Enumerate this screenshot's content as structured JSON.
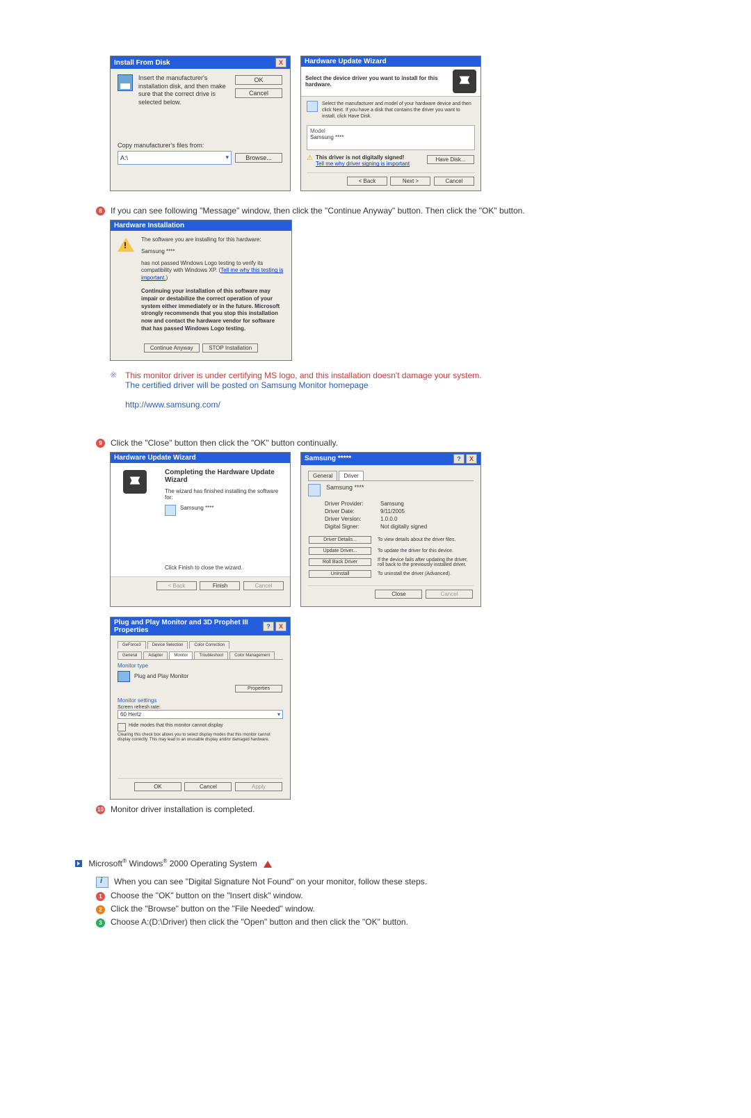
{
  "install_from_disk": {
    "title": "Install From Disk",
    "instr": "Insert the manufacturer's installation disk, and then make sure that the correct drive is selected below.",
    "ok": "OK",
    "cancel": "Cancel",
    "copy_label": "Copy manufacturer's files from:",
    "dropdown_value": "A:\\",
    "browse": "Browse..."
  },
  "hw_update_select": {
    "title": "Hardware Update Wizard",
    "heading": "Select the device driver you want to install for this hardware.",
    "instr": "Select the manufacturer and model of your hardware device and then click Next. If you have a disk that contains the driver you want to install, click Have Disk.",
    "model_label": "Model",
    "model_value": "Samsung ****",
    "warn": "This driver is not digitally signed!",
    "warn_link": "Tell me why driver signing is important",
    "have_disk": "Have Disk...",
    "back": "< Back",
    "next": "Next >",
    "cancel": "Cancel"
  },
  "step8": {
    "num": "8",
    "text": "If you can see following \"Message\" window, then click the \"Continue Anyway\" button. Then click the \"OK\" button."
  },
  "hw_install": {
    "title": "Hardware Installation",
    "line1": "The software you are installing for this hardware:",
    "device": "Samsung ****",
    "line2a": "has not passed Windows Logo testing to verify its compatibility with Windows XP. (",
    "line2_link": "Tell me why this testing is important.",
    "line2b": ")",
    "bold": "Continuing your installation of this software may impair or destabilize the correct operation of your system either immediately or in the future. Microsoft strongly recommends that you stop this installation now and contact the hardware vendor for software that has passed Windows Logo testing.",
    "continue": "Continue Anyway",
    "stop": "STOP Installation"
  },
  "note": {
    "red": "This monitor driver is under certifying MS logo, and this installation doesn't damage your system.",
    "blue": "The certified driver will be posted on Samsung Monitor homepage",
    "url": "http://www.samsung.com/"
  },
  "step9": {
    "num": "9",
    "text": "Click the \"Close\" button then click the \"OK\" button continually."
  },
  "hw_complete": {
    "title": "Hardware Update Wizard",
    "heading": "Completing the Hardware Update Wizard",
    "sub": "The wizard has finished installing the software for:",
    "device": "Samsung ****",
    "hint": "Click Finish to close the wizard.",
    "back": "< Back",
    "finish": "Finish",
    "cancel": "Cancel"
  },
  "driver_props": {
    "title": "Samsung *****",
    "tab_general": "General",
    "tab_driver": "Driver",
    "device": "Samsung ****",
    "prov_l": "Driver Provider:",
    "prov_v": "Samsung",
    "date_l": "Driver Date:",
    "date_v": "9/11/2005",
    "ver_l": "Driver Version:",
    "ver_v": "1.0.0.0",
    "sig_l": "Digital Signer:",
    "sig_v": "Not digitally signed",
    "btn_details": "Driver Details...",
    "btn_details_t": "To view details about the driver files.",
    "btn_update": "Update Driver...",
    "btn_update_t": "To update the driver for this device.",
    "btn_rollback": "Roll Back Driver",
    "btn_rollback_t": "If the device fails after updating the driver, roll back to the previously installed driver.",
    "btn_uninstall": "Uninstall",
    "btn_uninstall_t": "To uninstall the driver (Advanced).",
    "close": "Close",
    "cancel": "Cancel"
  },
  "monitor_props": {
    "title": "Plug and Play Monitor and 3D Prophet III Properties",
    "tabs": [
      "GeForce3",
      "Device Selection",
      "Color Correction",
      "General",
      "Adapter",
      "Monitor",
      "Troubleshoot",
      "Color Management"
    ],
    "sec_type": "Monitor type",
    "type_val": "Plug and Play Monitor",
    "properties": "Properties",
    "sec_settings": "Monitor settings",
    "refresh_l": "Screen refresh rate:",
    "refresh_v": "60 Hertz",
    "chk": "Hide modes that this monitor cannot display",
    "chk_desc": "Clearing this check box allows you to select display modes that this monitor cannot display correctly. This may lead to an unusable display and/or damaged hardware.",
    "ok": "OK",
    "cancel": "Cancel",
    "apply": "Apply"
  },
  "step10": {
    "num": "10",
    "text": "Monitor driver installation is completed."
  },
  "win2000": {
    "heading_pre": "Microsoft",
    "heading_mid": " Windows",
    "heading_post": " 2000 Operating System",
    "intro": "When you can see \"Digital Signature Not Found\" on your monitor, follow these steps.",
    "s1n": "1",
    "s1": "Choose the \"OK\" button on the \"Insert disk\" window.",
    "s2n": "2",
    "s2": "Click the \"Browse\" button on the \"File Needed\" window.",
    "s3n": "3",
    "s3": "Choose A:(D:\\Driver) then click the \"Open\" button and then click the \"OK\" button."
  }
}
